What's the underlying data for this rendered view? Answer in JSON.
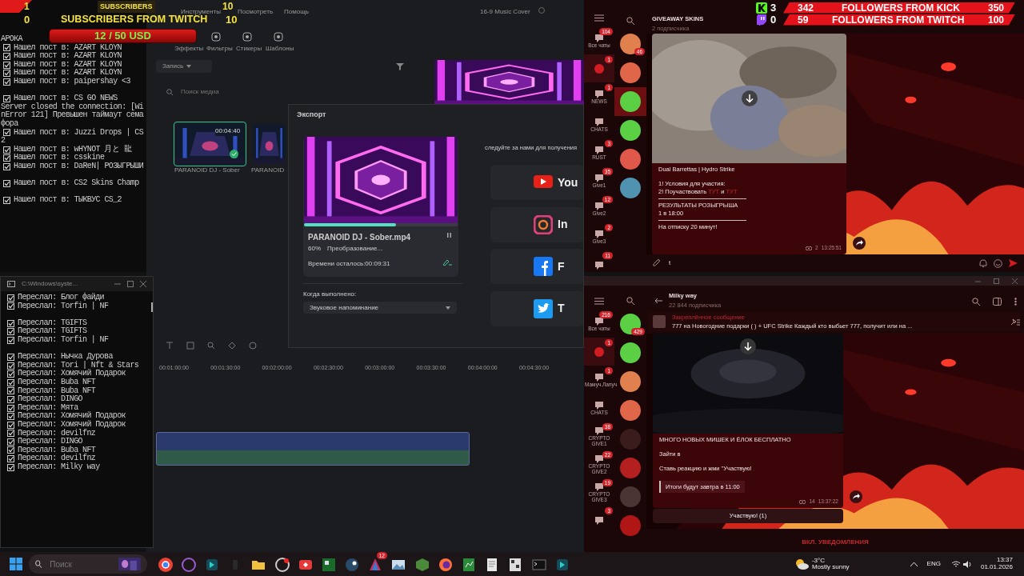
{
  "overlay_subscribers": {
    "rows": [
      {
        "count": "1",
        "label": "SUBSCRIBERS",
        "goal": "10"
      },
      {
        "count": "0",
        "label": "SUBSCRIBERS FROM TWITCH",
        "goal": "10"
      }
    ],
    "donation": "12 / 50 USD"
  },
  "overlay_followers": {
    "rows": [
      {
        "kind": "kick",
        "total": "3",
        "count": "342",
        "label": "FOLLOWERS FROM KICK",
        "goal": "350"
      },
      {
        "kind": "twitch",
        "total": "0",
        "count": "59",
        "label": "FOLLOWERS FROM TWITCH",
        "goal": "100"
      }
    ]
  },
  "console_top": {
    "lines": [
      {
        "kind": "plain",
        "text": "АРОКА"
      },
      {
        "kind": "check",
        "checked": true,
        "text": "Нашел пост в: AZART KLOYN"
      },
      {
        "kind": "check",
        "checked": true,
        "text": "Нашел пост в: AZART KLOYN"
      },
      {
        "kind": "check",
        "checked": true,
        "text": "Нашел пост в: AZART KLOYN"
      },
      {
        "kind": "check",
        "checked": true,
        "text": "Нашел пост в: AZART KLOYN"
      },
      {
        "kind": "check",
        "checked": true,
        "text": "Нашел пост в: paipershay <3"
      },
      {
        "kind": "gap"
      },
      {
        "kind": "check",
        "checked": true,
        "text": "Нашел пост в: CS GO NEWS"
      },
      {
        "kind": "plain",
        "text": "Server closed the connection: [Wi"
      },
      {
        "kind": "plain",
        "text": "nError 121] Превышен таймаут сема"
      },
      {
        "kind": "plain",
        "text": "фора"
      },
      {
        "kind": "check",
        "checked": true,
        "text": "Нашел пост в: Juzzi Drops | CS"
      },
      {
        "kind": "plain",
        "text": "2"
      },
      {
        "kind": "check",
        "checked": true,
        "text": "Нашел пост в: wHYNOT 月と 龍"
      },
      {
        "kind": "check",
        "checked": true,
        "text": "Нашел пост в: csskine"
      },
      {
        "kind": "check",
        "checked": true,
        "text": "Нашел пост в: DaReN| РОЗЫГРЫШИ"
      },
      {
        "kind": "gap"
      },
      {
        "kind": "check",
        "checked": true,
        "text": "Нашел пост в: CS2 Skins Champ"
      },
      {
        "kind": "gap"
      },
      {
        "kind": "check",
        "checked": true,
        "text": "Нашел пост в: ТЫКВУС CS_2"
      }
    ]
  },
  "console_bottom": {
    "title": "C:\\Windows\\syste...",
    "lines": [
      {
        "kind": "check",
        "checked": true,
        "text": "Переслал: Блог файди"
      },
      {
        "kind": "check",
        "checked": true,
        "text": "Переслал: Torfin | NF"
      },
      {
        "kind": "gap"
      },
      {
        "kind": "check",
        "checked": true,
        "text": "Переслал: TGIFTS"
      },
      {
        "kind": "check",
        "checked": true,
        "text": "Переслал: TGIFTS"
      },
      {
        "kind": "check",
        "checked": true,
        "text": "Переслал: Torfin | NF"
      },
      {
        "kind": "gap"
      },
      {
        "kind": "check",
        "checked": true,
        "text": "Переслал: Нычка Дурова"
      },
      {
        "kind": "check",
        "checked": true,
        "text": "Переслал: Tori | Nft & Stars"
      },
      {
        "kind": "check",
        "checked": true,
        "text": "Переслал: Хомячий Подарок"
      },
      {
        "kind": "check",
        "checked": true,
        "text": "Переслал: Buba NFT"
      },
      {
        "kind": "check",
        "checked": true,
        "text": "Переслал: Buba NFT"
      },
      {
        "kind": "check",
        "checked": true,
        "text": "Переслал: DINGO"
      },
      {
        "kind": "check",
        "checked": true,
        "text": "Переслал: Мята"
      },
      {
        "kind": "check",
        "checked": true,
        "text": "Переслал: Хомячий Подарок"
      },
      {
        "kind": "check",
        "checked": true,
        "text": "Переслал: Хомячий Подарок"
      },
      {
        "kind": "check",
        "checked": true,
        "text": "Переслал: devilfnz"
      },
      {
        "kind": "check",
        "checked": true,
        "text": "Переслал: DINGO"
      },
      {
        "kind": "check",
        "checked": true,
        "text": "Переслал: Buba NFT"
      },
      {
        "kind": "check",
        "checked": true,
        "text": "Переслал: devilfnz"
      },
      {
        "kind": "check",
        "checked": true,
        "text": "Переслал: Milky way"
      }
    ]
  },
  "editor": {
    "title": "16-9 Music Cover",
    "menu": [
      "Инструменты",
      "Посмотреть",
      "Помощь"
    ],
    "tools": [
      "Эффекты",
      "Фильтры",
      "Стикеры",
      "Шаблоны"
    ],
    "record_label": "Запись",
    "search_placeholder": "Поиск медиа",
    "media": [
      {
        "label": "PARANOID DJ - Sober",
        "duration": "00:04:40",
        "selected": true
      },
      {
        "label": "PARANOID",
        "selected": false
      }
    ],
    "ticks": [
      "00:01:00:00",
      "00:01:30:00",
      "00:02:00:00",
      "00:02:30:00",
      "00:03:00:00",
      "00:03:30:00",
      "00:04:00:00",
      "00:04:30:00"
    ]
  },
  "export_dialog": {
    "title": "Экспорт",
    "file": "PARANOID DJ - Sober.mp4",
    "percent": "60%",
    "status": "Преобразование...",
    "level": 0.6,
    "remaining": "Времени осталось:00:09:31",
    "when_label": "Когда выполнено:",
    "when_value": "Звуковое напоминание",
    "follow_text": "следуйте за нами для получения",
    "socials": [
      {
        "kind": "youtube",
        "label": "You"
      },
      {
        "kind": "instagram",
        "label": "In"
      },
      {
        "kind": "facebook",
        "label": "F"
      },
      {
        "kind": "twitter",
        "label": "T"
      }
    ]
  },
  "telegram_top": {
    "folders": [
      {
        "label": "Все чаты",
        "badge": "104",
        "selected": false
      },
      {
        "badge": "1",
        "selected": true
      },
      {
        "label": "NEWS",
        "badge": "1",
        "selected": false
      },
      {
        "label": "CHATS",
        "selected": false
      },
      {
        "label": "RUST",
        "badge": "3",
        "selected": false
      },
      {
        "label": "Give1",
        "badge": "35",
        "selected": false
      },
      {
        "label": "Give2",
        "badge": "12",
        "selected": false
      },
      {
        "label": "Give3",
        "badge": "2",
        "selected": false
      },
      {
        "badge": "11",
        "selected": false
      }
    ],
    "chats": [
      {
        "color": "#e0804e",
        "badge": "46",
        "selected": false
      },
      {
        "color": "#e0664a",
        "selected": false
      },
      {
        "color": "#5cd045",
        "selected": true
      },
      {
        "color": "#5cd045",
        "selected": false
      },
      {
        "color": "#e0584a",
        "selected": false
      },
      {
        "color": "#4f93b0",
        "selected": false
      }
    ],
    "title": "GIVEAWAY SKINS",
    "subtitle": "2 подписчика",
    "message": {
      "paragraphs": [
        {
          "kind": "text",
          "parts": [
            {
              "text": "Dual Barrettas | Hydro Strike"
            }
          ]
        },
        {
          "kind": "gap"
        },
        {
          "kind": "text",
          "parts": [
            {
              "text": "1! Условия для участия:"
            }
          ]
        },
        {
          "kind": "text",
          "parts": [
            {
              "text": "2! Поучаствовать "
            },
            {
              "text": "ТУТ",
              "link": true
            },
            {
              "text": " и "
            },
            {
              "text": "ТУТ",
              "link": true
            }
          ]
        },
        {
          "kind": "rule"
        },
        {
          "kind": "text",
          "parts": [
            {
              "text": "РЕЗУЛЬТАТЫ РОЗЫГРЫША"
            }
          ]
        },
        {
          "kind": "text",
          "parts": [
            {
              "text": "1 в 18:00"
            }
          ]
        },
        {
          "kind": "rule"
        },
        {
          "kind": "text",
          "parts": [
            {
              "text": "На отписку 20 минут!"
            }
          ]
        }
      ],
      "views": "2",
      "time": "13:25:51"
    },
    "input_value": "t"
  },
  "telegram_bottom": {
    "folders": [
      {
        "label": "Все чаты",
        "badge": "216",
        "selected": false
      },
      {
        "badge": "1",
        "selected": true
      },
      {
        "label": "Мамуч.Лапуч",
        "badge": "1",
        "selected": false
      },
      {
        "label": "CHATS",
        "selected": false
      },
      {
        "label": "CRYPTO GIVE1",
        "badge": "38",
        "selected": false
      },
      {
        "label": "CRYPTO GIVE2",
        "badge": "22",
        "selected": false
      },
      {
        "label": "CRYPTO GIVE3",
        "badge": "19",
        "selected": false
      },
      {
        "badge": "3",
        "selected": false
      }
    ],
    "chats": [
      {
        "color": "#5cd045",
        "badge": "429",
        "selected": false
      },
      {
        "color": "#5cd045",
        "selected": false
      },
      {
        "color": "#e0804e",
        "selected": false
      },
      {
        "color": "#e0664a",
        "selected": false
      },
      {
        "color": "#3a1c1c",
        "selected": false
      },
      {
        "color": "#b42020",
        "selected": false
      },
      {
        "color": "#4a3434",
        "selected": false
      },
      {
        "color": "#b01616",
        "selected": false
      }
    ],
    "title": "Milky way",
    "subtitle": "22 844 подписчика",
    "pinned": {
      "label": "Закреплённое сообщение",
      "text": "777 на Новогодние подарки ( ) + UFC Strike Каждый кто выбьет 777, получит или на ..."
    },
    "message": {
      "paragraphs": [
        {
          "kind": "text",
          "parts": [
            {
              "text": "МНОГО НОВЫХ МИШЕК И ЁЛОК  БЕСПЛАТНО"
            }
          ]
        },
        {
          "kind": "gap"
        },
        {
          "kind": "text",
          "parts": [
            {
              "text": "Зайти в"
            }
          ]
        },
        {
          "kind": "gap"
        },
        {
          "kind": "text",
          "parts": [
            {
              "text": "Ставь реакцию и жми \"Участвую!"
            }
          ]
        },
        {
          "kind": "gap"
        },
        {
          "kind": "quote",
          "parts": [
            {
              "text": "Итоги будут завтра в 11:00"
            }
          ]
        }
      ],
      "views": "14",
      "time": "13:37:22"
    },
    "action_button": "Участвую! (1)",
    "footer_action": "ВКЛ. УВЕДОМЛЕНИЯ"
  },
  "taskbar": {
    "search_placeholder": "Поиск",
    "badge": "12",
    "weather_temp": "-3°C",
    "weather_text": "Mostly sunny",
    "lang": "ENG",
    "time": "13:37",
    "date": "01.01.2026"
  }
}
